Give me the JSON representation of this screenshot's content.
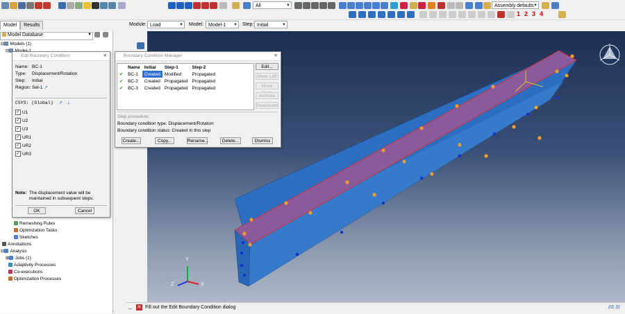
{
  "toolbar": {
    "selection_filter": "All",
    "view_option": "Assembly defaults",
    "numbers": [
      "1",
      "2",
      "3",
      "4"
    ]
  },
  "context_bar": {
    "module_label": "Module:",
    "module_value": "Load",
    "model_label": "Model:",
    "model_value": "Model-1",
    "step_label": "Step:",
    "step_value": "Initial"
  },
  "tabs": [
    "Model",
    "Results"
  ],
  "tree": {
    "header": "Model Database",
    "items": [
      "Models (1)",
      "Model-1",
      "Remeshing Rules",
      "Optimization Tasks",
      "Sketches",
      "Annotations",
      "Analysis",
      "Jobs (1)",
      "Adaptivity Processes",
      "Co-executions",
      "Optimization Processes"
    ]
  },
  "edit_bc": {
    "title": "Edit Boundary Condition",
    "name_label": "Name:",
    "name_value": "BC-1",
    "type_label": "Type:",
    "type_value": "Displacement/Rotation",
    "step_label": "Step:",
    "step_value": "Initial",
    "region_label": "Region:",
    "region_value": "Set-1",
    "csys_label": "CSYS:",
    "csys_value": "(Global)",
    "dofs": [
      "U1",
      "U2",
      "U3",
      "UR1",
      "UR2",
      "UR3"
    ],
    "note_label": "Note:",
    "note_text": "The displacement value will be maintained in subsequent steps.",
    "ok": "OK",
    "cancel": "Cancel"
  },
  "manager": {
    "title": "Boundary Condition Manager",
    "columns": [
      "Name",
      "Initial",
      "Step-1",
      "Step-2"
    ],
    "rows": [
      [
        "BC-1",
        "Created",
        "Modified",
        "Propagated"
      ],
      [
        "BC-2",
        "Created",
        "Propagated",
        "Propagated"
      ],
      [
        "BC-3",
        "Created",
        "Propagated",
        "Propagated"
      ]
    ],
    "side_buttons": [
      "Edit...",
      "Move Left",
      "Move Right",
      "Activate",
      "Deactivate"
    ],
    "step_procedure_label": "Step procedure:",
    "type_line": "Boundary condition type:  Displacement/Rotation",
    "status_line": "Boundary condition status: Created in this step",
    "buttons": [
      "Create...",
      "Copy...",
      "Rename...",
      "Delete...",
      "Dismiss"
    ]
  },
  "status_bar": {
    "prompt": "Fill out the Edit Boundary Condition dialog"
  },
  "axes": {
    "x": "X",
    "y": "Y",
    "z": "Z"
  },
  "colors": {
    "viewport_top": "#1c2f55",
    "beam": "#2c6fc2",
    "face": "#8a5a9a",
    "marker": "#f39c2a",
    "accent": "#2f6fd1"
  }
}
